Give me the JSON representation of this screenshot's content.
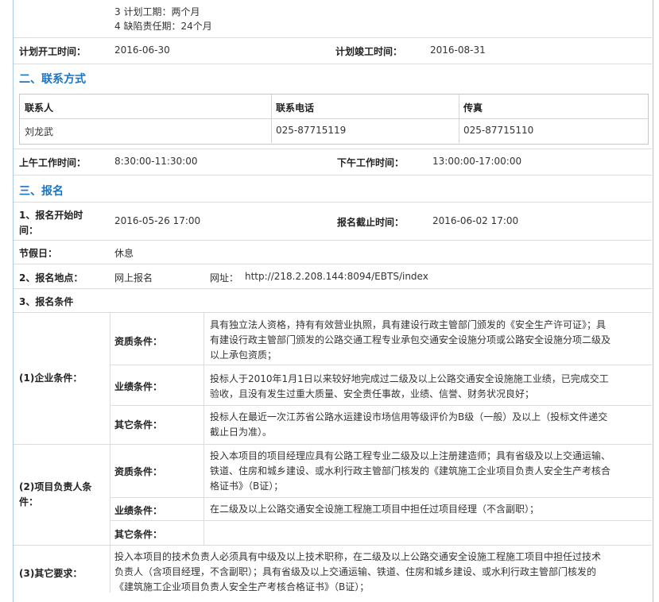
{
  "top_partial": "                                     ",
  "top_lines": [
    "3 计划工期：两个月",
    "4 缺陷责任期：24个月"
  ],
  "schedule": {
    "start_label": "计划开工时间：",
    "start_value": "2016-06-30",
    "end_label": "计划竣工时间：",
    "end_value": "2016-08-31"
  },
  "contact_section": "二、联系方式",
  "contact_table": {
    "headers": [
      "联系人",
      "联系电话",
      "传真"
    ],
    "row": [
      "刘龙武",
      "025-87715119",
      "025-87715110"
    ]
  },
  "hours": {
    "am_label": "上午工作时间：",
    "am_value": "8:30:00-11:30:00",
    "pm_label": "下午工作时间：",
    "pm_value": "13:00:00-17:00:00"
  },
  "signup_section": "三、报名",
  "signup": {
    "start_label_1": "1、报名开始时",
    "start_label_2": "间：",
    "start_value": "2016-05-26 17:00",
    "deadline_label": "报名截止时间：",
    "deadline_value": "2016-06-02 17:00",
    "holiday_label": "节假日：",
    "holiday_value": "休息",
    "place_label": "2、报名地点：",
    "place_value": "网上报名",
    "url_label": "网址：",
    "url_value": "http://218.2.208.144:8094/EBTS/index",
    "cond_label": "3、报名条件"
  },
  "enterprise": {
    "label": "(1)企业条件：",
    "qual_label": "资质条件：",
    "qual_lines": [
      "具有独立法人资格，持有有效营业执照，具有建设行政主管部门颁发的《安全生产许可证》；具",
      "有建设行政主管部门颁发的公路交通工程专业承包交通安全设施分项或公路安全设施分项二级及",
      "以上承包资质；"
    ],
    "perf_label": "业绩条件：",
    "perf_lines": [
      "投标人于2010年1月1日以来较好地完成过二级及以上公路交通安全设施施工业绩，已完成交工",
      "验收，且没有发生过重大质量、安全责任事故，业绩、信誉、财务状况良好；"
    ],
    "other_label": "其它条件：",
    "other_lines": [
      "投标人在最近一次江苏省公路水运建设市场信用等级评价为B级（一般）及以上（投标文件递交",
      "截止日为准）。"
    ]
  },
  "manager": {
    "label_1": "(2)项目负责人条",
    "label_2": "件：",
    "qual_label": "资质条件：",
    "qual_lines": [
      "投入本项目的项目经理应具有公路工程专业二级及以上注册建造师；具有省级及以上交通运输、",
      "铁道、住房和城乡建设、或水利行政主管部门核发的《建筑施工企业项目负责人安全生产考核合",
      "格证书》（B证）；"
    ],
    "perf_label": "业绩条件：",
    "perf_lines": [
      "在二级及以上公路交通安全设施工程施工项目中担任过项目经理（不含副职）；"
    ],
    "other_label": "其它条件："
  },
  "other_req": {
    "label": "(3)其它要求：",
    "lines": [
      "投入本项目的技术负责人必须具有中级及以上技术职称，在二级及以上公路交通安全设施工程施工项目中担任过技术",
      "负责人（含项目经理，不含副职）；具有省级及以上交通运输、铁道、住房和城乡建设、或水利行政主管部门核发的",
      "《建筑施工企业项目负责人安全生产考核合格证书》（B证）；"
    ]
  }
}
